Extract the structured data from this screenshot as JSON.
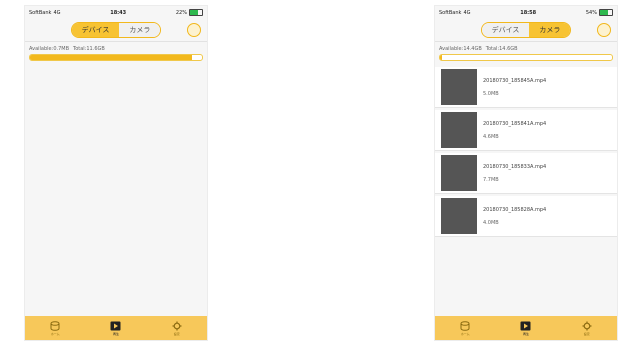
{
  "phones": [
    {
      "status": {
        "carrier": "SoftBank",
        "network": "4G",
        "time": "18:43",
        "battery": "22%"
      },
      "tabs": [
        {
          "label": "デバイス",
          "active": true
        },
        {
          "label": "カメラ",
          "active": false
        }
      ],
      "storage": {
        "available": "Available:0.7MB",
        "total": "Total:11.6GB",
        "used_percent": 94
      },
      "files": [],
      "tabbar": [
        {
          "label": "ホーム",
          "icon": "storage-icon",
          "active": false
        },
        {
          "label": "再生",
          "icon": "play-icon",
          "active": true
        },
        {
          "label": "設定",
          "icon": "gear-icon",
          "active": false
        }
      ]
    },
    {
      "status": {
        "carrier": "SoftBank",
        "network": "4G",
        "time": "18:58",
        "battery": "54%"
      },
      "tabs": [
        {
          "label": "デバイス",
          "active": false
        },
        {
          "label": "カメラ",
          "active": true
        }
      ],
      "storage": {
        "available": "Available:14.4GB",
        "total": "Total:14.6GB",
        "used_percent": 1
      },
      "files": [
        {
          "name": "20180730_185845A.mp4",
          "size": "5.0MB"
        },
        {
          "name": "20180730_185841A.mp4",
          "size": "4.6MB"
        },
        {
          "name": "20180730_185833A.mp4",
          "size": "7.7MB"
        },
        {
          "name": "20180730_185828A.mp4",
          "size": "4.0MB"
        }
      ],
      "tabbar": [
        {
          "label": "ホーム",
          "icon": "storage-icon",
          "active": false
        },
        {
          "label": "再生",
          "icon": "play-icon",
          "active": true
        },
        {
          "label": "設定",
          "icon": "gear-icon",
          "active": false
        }
      ]
    }
  ],
  "colors": {
    "accent": "#f2b81c",
    "tabbar": "#f7c85a",
    "thumb": "#555555"
  }
}
